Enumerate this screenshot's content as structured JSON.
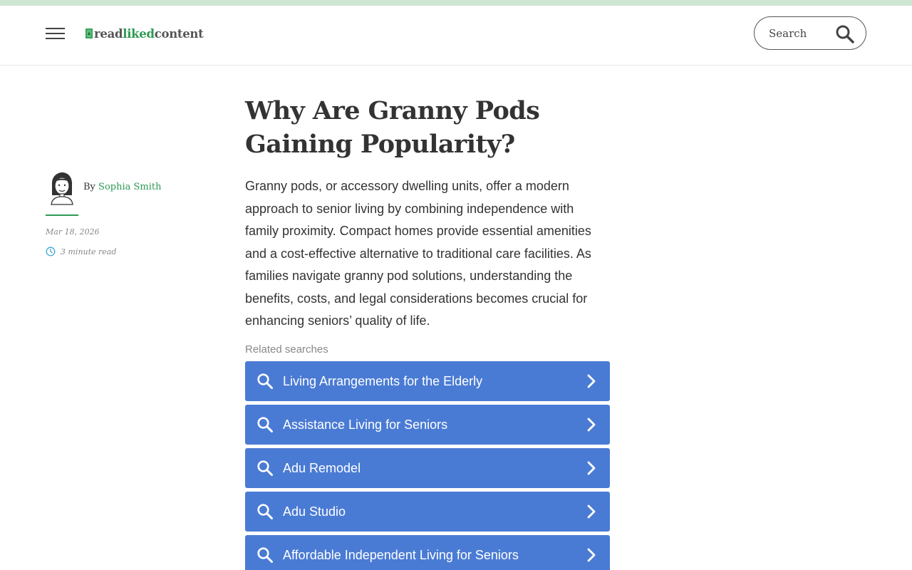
{
  "brand": {
    "logo_word1": "read",
    "logo_word2": "liked",
    "logo_word3": "content",
    "accent_color": "#2e9a52",
    "strip_color": "#cfe6d4"
  },
  "header": {
    "menu_icon": "hamburger-menu-icon",
    "search": {
      "placeholder": "Search",
      "icon": "search-icon"
    }
  },
  "author": {
    "by_prefix": "By",
    "name": "Sophia Smith",
    "avatar_icon": "author-avatar",
    "date": "Mar 18, 2026",
    "read_time": "3 minute read",
    "read_time_icon": "clock-icon"
  },
  "article": {
    "title": "Why Are Granny Pods Gaining Popularity?",
    "intro": "Granny pods, or accessory dwelling units, offer a modern approach to senior living by combining independence with family proximity. Compact homes provide essential amenities and a cost-effective alternative to traditional care facilities. As families navigate granny pod solutions, understanding the benefits, costs, and legal considerations becomes crucial for enhancing seniors’ quality of life."
  },
  "related": {
    "label": "Related searches",
    "button_color": "#4a7bd4",
    "items": [
      {
        "label": "Living Arrangements for the Elderly"
      },
      {
        "label": "Assistance Living for Seniors"
      },
      {
        "label": "Adu Remodel"
      },
      {
        "label": "Adu Studio"
      },
      {
        "label": "Affordable Independent Living for Seniors"
      }
    ]
  }
}
